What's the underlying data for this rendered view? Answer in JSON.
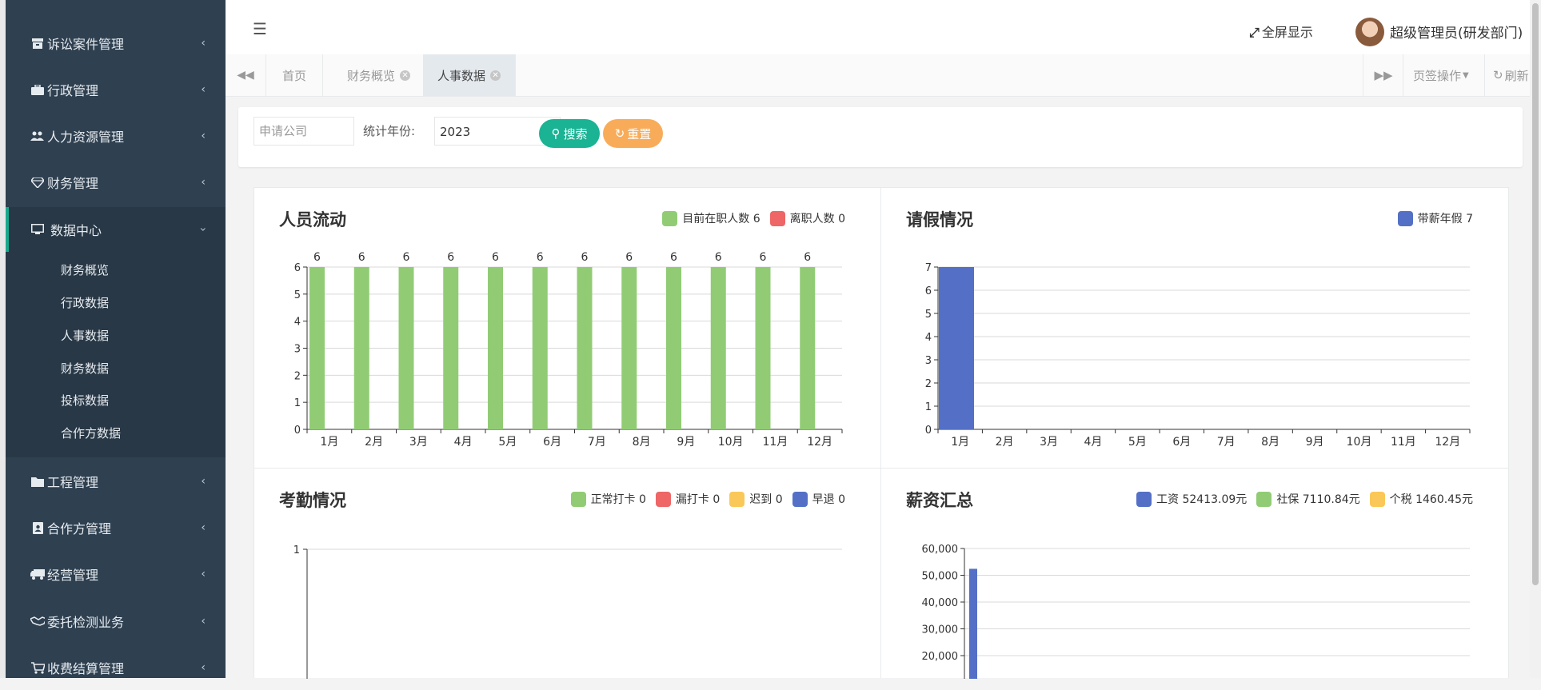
{
  "sidebar": {
    "items": [
      {
        "label": "诉讼案件管理",
        "icon": "archive-icon"
      },
      {
        "label": "行政管理",
        "icon": "briefcase-icon"
      },
      {
        "label": "人力资源管理",
        "icon": "users-icon"
      },
      {
        "label": "财务管理",
        "icon": "diamond-icon"
      },
      {
        "label": "数据中心",
        "icon": "desktop-icon"
      },
      {
        "label": "工程管理",
        "icon": "folder-icon"
      },
      {
        "label": "合作方管理",
        "icon": "address-book-icon"
      },
      {
        "label": "经营管理",
        "icon": "truck-icon"
      },
      {
        "label": "委托检测业务",
        "icon": "handshake-icon"
      },
      {
        "label": "收费结算管理",
        "icon": "cart-icon"
      }
    ],
    "sub_items": [
      "财务概览",
      "行政数据",
      "人事数据",
      "财务数据",
      "投标数据",
      "合作方数据"
    ]
  },
  "header": {
    "fullscreen_label": "全屏显示",
    "user_label": "超级管理员(研发部门)"
  },
  "tabs": {
    "items": [
      {
        "label": "首页",
        "closable": false
      },
      {
        "label": "财务概览",
        "closable": true
      },
      {
        "label": "人事数据",
        "closable": true,
        "active": true
      }
    ],
    "page_ops_label": "页签操作",
    "refresh_label": "刷新"
  },
  "search": {
    "company_placeholder": "申请公司",
    "year_label": "统计年份:",
    "year_value": "2023",
    "search_label": "搜索",
    "reset_label": "重置"
  },
  "colors": {
    "green": "#91cc75",
    "red": "#ee6666",
    "yellow": "#fac858",
    "blue": "#5470c6",
    "teal": "#1ab394",
    "orange": "#f8ac59",
    "sidebar": "#2f4050"
  },
  "panels": {
    "flow": {
      "title": "人员流动",
      "legend": [
        "目前在职人数 6",
        "离职人数 0"
      ]
    },
    "leave": {
      "title": "请假情况",
      "legend": [
        "带薪年假 7"
      ]
    },
    "attendance": {
      "title": "考勤情况",
      "legend": [
        "正常打卡 0",
        "漏打卡 0",
        "迟到 0",
        "早退 0"
      ]
    },
    "salary": {
      "title": "薪资汇总",
      "legend": [
        "工资 52413.09元",
        "社保 7110.84元",
        "个税 1460.45元"
      ]
    }
  },
  "chart_data": [
    {
      "type": "bar",
      "title": "人员流动",
      "categories": [
        "1月",
        "2月",
        "3月",
        "4月",
        "5月",
        "6月",
        "7月",
        "8月",
        "9月",
        "10月",
        "11月",
        "12月"
      ],
      "series": [
        {
          "name": "目前在职人数",
          "values": [
            6,
            6,
            6,
            6,
            6,
            6,
            6,
            6,
            6,
            6,
            6,
            6
          ],
          "color": "#91cc75"
        },
        {
          "name": "离职人数",
          "values": [
            0,
            0,
            0,
            0,
            0,
            0,
            0,
            0,
            0,
            0,
            0,
            0
          ],
          "color": "#ee6666"
        }
      ],
      "ylim": [
        0,
        6
      ],
      "yticks": [
        "0",
        "1",
        "2",
        "3",
        "4",
        "5",
        "6"
      ],
      "data_labels": true,
      "grid": true
    },
    {
      "type": "bar",
      "title": "请假情况",
      "categories": [
        "1月",
        "2月",
        "3月",
        "4月",
        "5月",
        "6月",
        "7月",
        "8月",
        "9月",
        "10月",
        "11月",
        "12月"
      ],
      "series": [
        {
          "name": "带薪年假",
          "values": [
            7,
            0,
            0,
            0,
            0,
            0,
            0,
            0,
            0,
            0,
            0,
            0
          ],
          "color": "#5470c6"
        }
      ],
      "ylim": [
        0,
        7
      ],
      "yticks": [
        "0",
        "1",
        "2",
        "3",
        "4",
        "5",
        "6",
        "7"
      ],
      "grid": true
    },
    {
      "type": "bar",
      "title": "考勤情况",
      "series": [
        {
          "name": "正常打卡",
          "values": [
            0
          ],
          "color": "#91cc75"
        },
        {
          "name": "漏打卡",
          "values": [
            0
          ],
          "color": "#ee6666"
        },
        {
          "name": "迟到",
          "values": [
            0
          ],
          "color": "#fac858"
        },
        {
          "name": "早退",
          "values": [
            0
          ],
          "color": "#5470c6"
        }
      ],
      "yticks": [
        "1"
      ],
      "grid": true
    },
    {
      "type": "bar",
      "title": "薪资汇总",
      "series": [
        {
          "name": "工资",
          "values": [
            52413.09
          ],
          "color": "#5470c6"
        },
        {
          "name": "社保",
          "values": [
            7110.84
          ],
          "color": "#91cc75"
        },
        {
          "name": "个税",
          "values": [
            1460.45
          ],
          "color": "#fac858"
        }
      ],
      "ylim": [
        0,
        60000
      ],
      "yticks": [
        "20,000",
        "30,000",
        "40,000",
        "50,000",
        "60,000"
      ],
      "grid": true
    }
  ]
}
